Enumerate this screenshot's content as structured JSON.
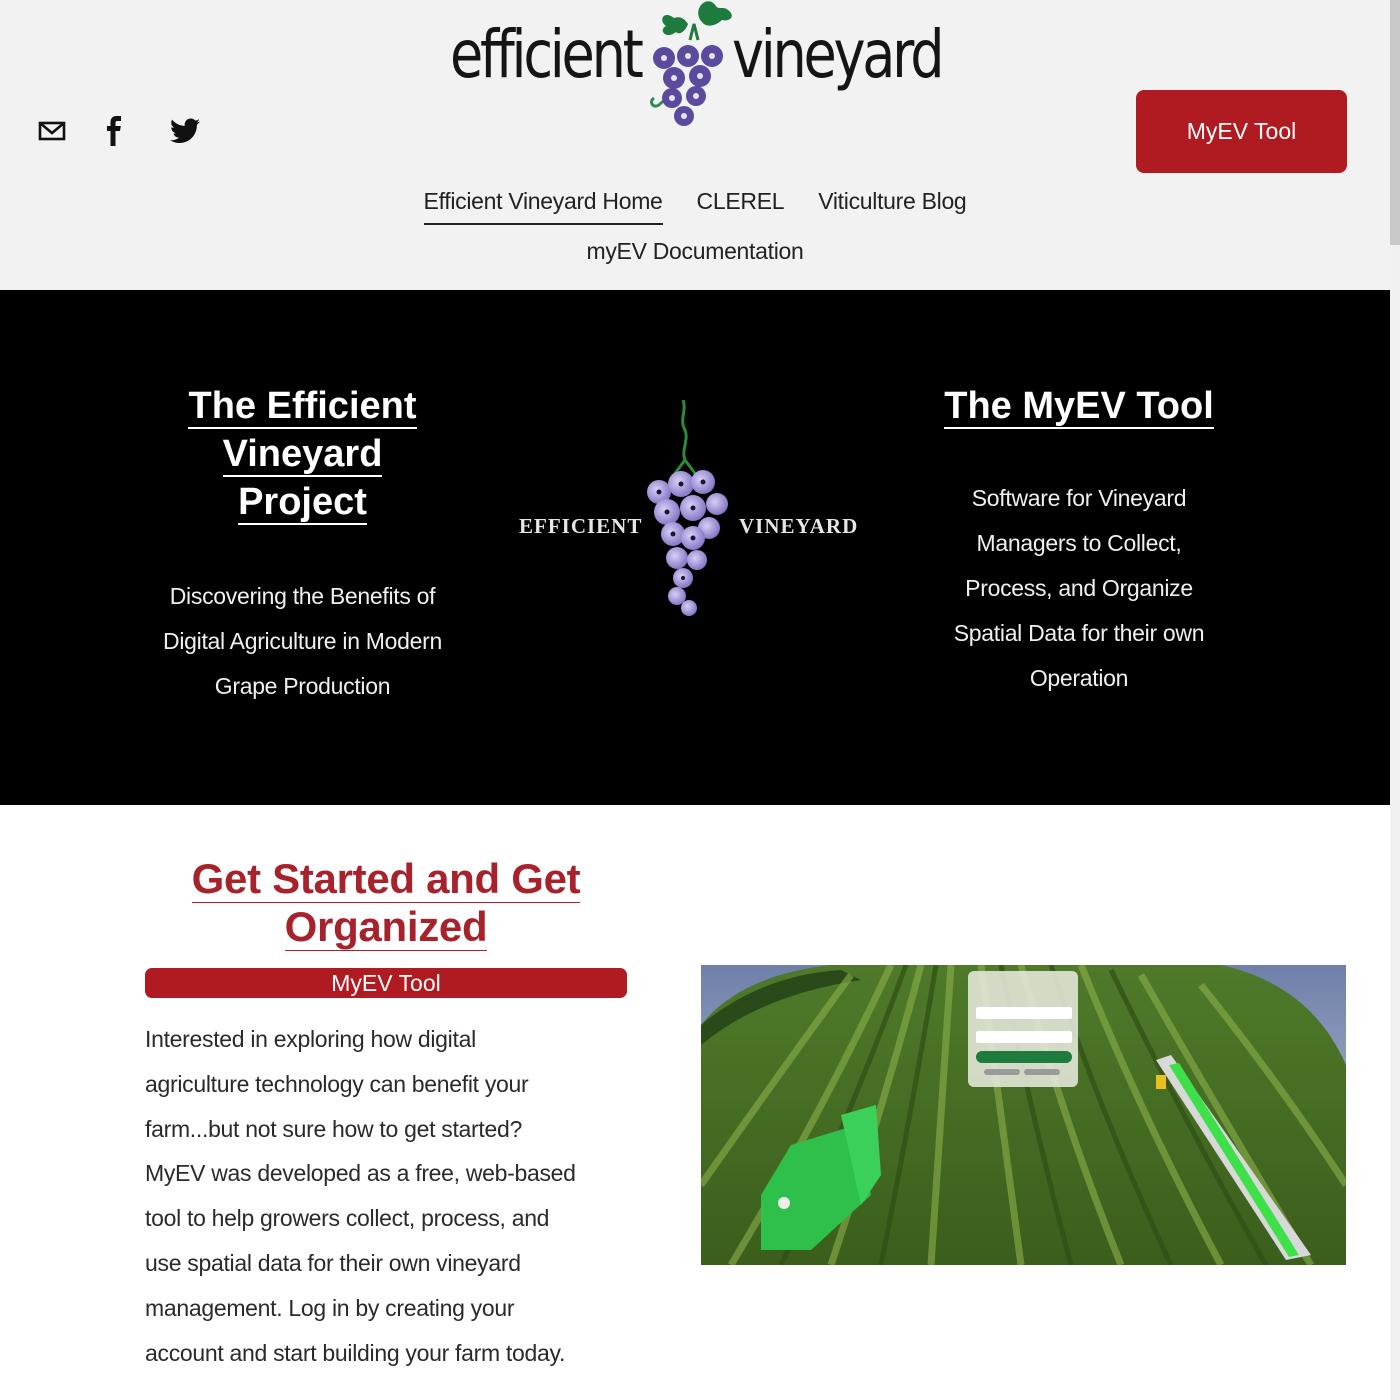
{
  "header": {
    "logo": {
      "left_word": "efficient",
      "right_word": "vineyard"
    },
    "social_icons": [
      {
        "name": "email",
        "icon": "mail-icon"
      },
      {
        "name": "facebook",
        "icon": "facebook-icon"
      },
      {
        "name": "twitter",
        "icon": "twitter-icon"
      }
    ],
    "cta_label": "MyEV Tool",
    "nav": {
      "items": [
        {
          "label": "Efficient Vineyard Home",
          "active": true
        },
        {
          "label": "CLEREL",
          "active": false
        },
        {
          "label": "Viticulture Blog",
          "active": false
        },
        {
          "label": "myEV Documentation",
          "active": false
        }
      ]
    }
  },
  "hero": {
    "left": {
      "title_lines": [
        "The Efficient",
        "Vineyard",
        "Project"
      ],
      "subtitle_lines": [
        "Discovering the Benefits of",
        "Digital Agriculture in Modern",
        "Grape Production"
      ]
    },
    "center_logo": {
      "left_word": "EFFICIENT",
      "right_word": "VINEYARD"
    },
    "right": {
      "title": "The MyEV Tool",
      "subtitle_lines": [
        "Software for Vineyard",
        "Managers to Collect,",
        "Process, and Organize",
        "Spatial Data for their own",
        "Operation"
      ]
    }
  },
  "content": {
    "title_lines": [
      "Get Started and Get",
      "Organized"
    ],
    "button_label": "MyEV Tool",
    "body_lines": [
      "Interested in exploring how digital",
      "agriculture technology can benefit your",
      "farm...but not sure how to get started?",
      "MyEV was developed as a free, web-based",
      "tool to help growers collect, process, and",
      "use spatial data for their own vineyard",
      "management. Log in by creating your",
      "account and start building your farm today."
    ],
    "image_alt": "Vineyard rows with harvester and MyEV login screen overlay"
  },
  "colors": {
    "accent_red": "#b01b22",
    "title_red": "#a8222c",
    "header_bg": "#f2f2f2",
    "hero_bg": "#000000",
    "grape_purple": "#5b4a9e",
    "leaf_green": "#1f7a3e"
  }
}
